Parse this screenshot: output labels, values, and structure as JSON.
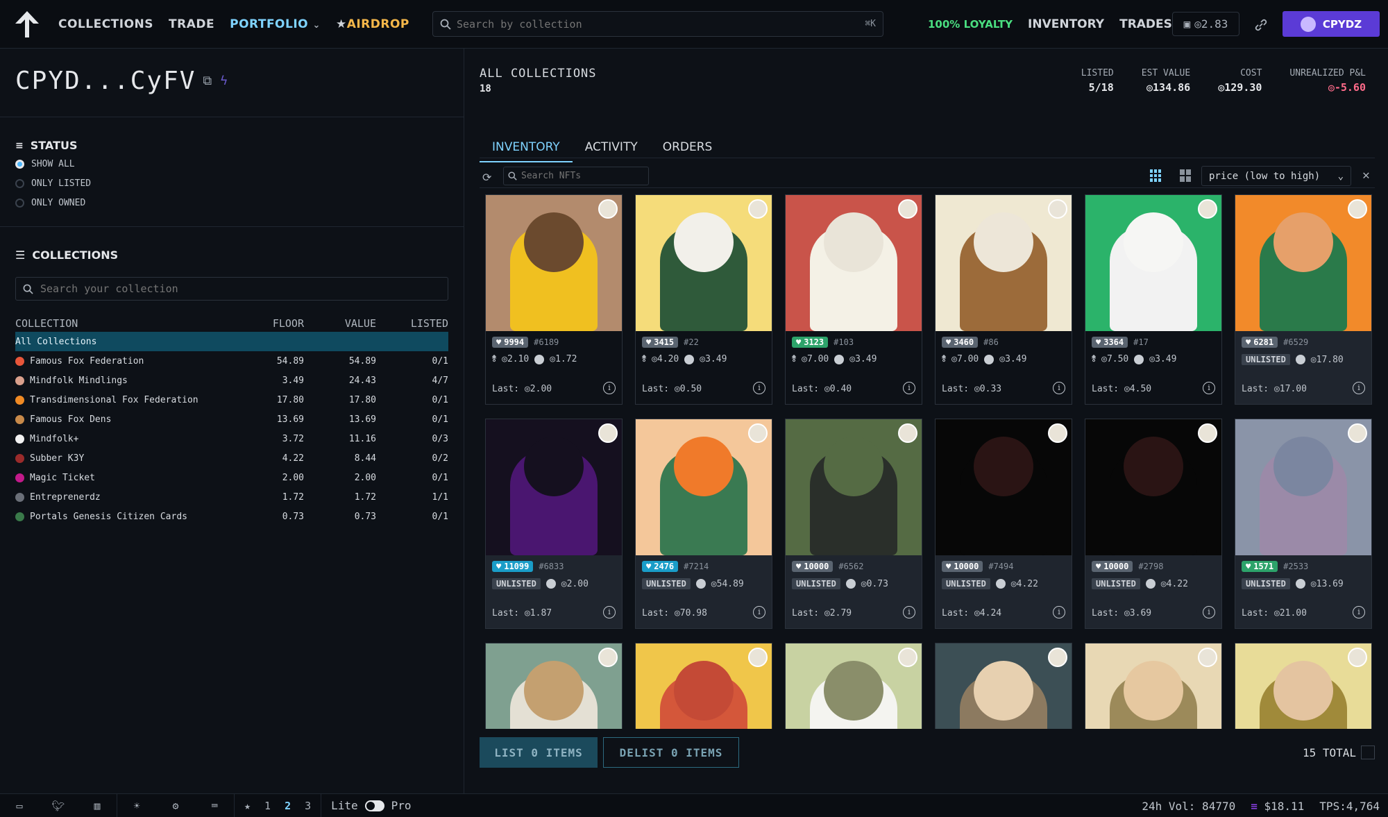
{
  "topnav": {
    "items": [
      "COLLECTIONS",
      "TRADE",
      "PORTFOLIO",
      "AIRDROP"
    ],
    "search_placeholder": "Search by collection",
    "search_kbd": "⌘K",
    "loyalty": "100% LOYALTY",
    "inventory": "INVENTORY",
    "trades": "TRADES",
    "wallet_balance": "◎2.83",
    "user": "CPYDZ"
  },
  "sidebar": {
    "address": "CPYD...CyFV",
    "status_title": "STATUS",
    "status_options": [
      "SHOW ALL",
      "ONLY LISTED",
      "ONLY OWNED"
    ],
    "collections_title": "COLLECTIONS",
    "collections_search_placeholder": "Search your collection",
    "headers": [
      "COLLECTION",
      "FLOOR",
      "VALUE",
      "LISTED"
    ],
    "rows": [
      {
        "name": "All Collections",
        "floor": "",
        "value": "",
        "listed": "",
        "color": ""
      },
      {
        "name": "Famous Fox Federation",
        "floor": "54.89",
        "value": "54.89",
        "listed": "0/1",
        "color": "#e8563a"
      },
      {
        "name": "Mindfolk Mindlings",
        "floor": "3.49",
        "value": "24.43",
        "listed": "4/7",
        "color": "#d9a08c"
      },
      {
        "name": "Transdimensional Fox Federation",
        "floor": "17.80",
        "value": "17.80",
        "listed": "0/1",
        "color": "#f08a24"
      },
      {
        "name": "Famous Fox Dens",
        "floor": "13.69",
        "value": "13.69",
        "listed": "0/1",
        "color": "#c88a4a"
      },
      {
        "name": "Mindfolk+",
        "floor": "3.72",
        "value": "11.16",
        "listed": "0/3",
        "color": "#f2f2f2"
      },
      {
        "name": "Subber K3Y",
        "floor": "4.22",
        "value": "8.44",
        "listed": "0/2",
        "color": "#9a2b2b"
      },
      {
        "name": "Magic Ticket",
        "floor": "2.00",
        "value": "2.00",
        "listed": "0/1",
        "color": "#c21a8a"
      },
      {
        "name": "Entreprenerdz",
        "floor": "1.72",
        "value": "1.72",
        "listed": "1/1",
        "color": "#6a6f78"
      },
      {
        "name": "Portals Genesis Citizen Cards",
        "floor": "0.73",
        "value": "0.73",
        "listed": "0/1",
        "color": "#3a7a4a"
      }
    ]
  },
  "main": {
    "title": "ALL COLLECTIONS",
    "count": "18",
    "stats": [
      {
        "label": "LISTED",
        "value": "5/18"
      },
      {
        "label": "EST VALUE",
        "value": "◎134.86"
      },
      {
        "label": "COST",
        "value": "◎129.30"
      },
      {
        "label": "UNREALIZED P&L",
        "value": "◎-5.60"
      }
    ],
    "tabs": [
      "INVENTORY",
      "ACTIVITY",
      "ORDERS"
    ],
    "nft_search_placeholder": "Search NFTs",
    "sort": "price (low to high)",
    "list_btn": "LIST 0 ITEMS",
    "delist_btn": "DELIST 0 ITEMS",
    "total": "15 TOTAL"
  },
  "cards": [
    {
      "rank": "9994",
      "id": "#6189",
      "listed": true,
      "price": "◎2.10",
      "floor": "◎1.72",
      "last": "Last: ◎2.00",
      "rank_color": "gray",
      "bg": "#b38b6d",
      "fig": "#f0c020",
      "head": "#6b4a2e"
    },
    {
      "rank": "3415",
      "id": "#22",
      "listed": true,
      "price": "◎4.20",
      "floor": "◎3.49",
      "last": "Last: ◎0.50",
      "rank_color": "gray",
      "bg": "#f5dc7a",
      "fig": "#2f5a3a",
      "head": "#f2f0ea"
    },
    {
      "rank": "3123",
      "id": "#103",
      "listed": true,
      "price": "◎7.00",
      "floor": "◎3.49",
      "last": "Last: ◎0.40",
      "rank_color": "green",
      "bg": "#c9544a",
      "fig": "#f4f1e6",
      "head": "#e9e4d8"
    },
    {
      "rank": "3460",
      "id": "#86",
      "listed": true,
      "price": "◎7.00",
      "floor": "◎3.49",
      "last": "Last: ◎0.33",
      "rank_color": "gray",
      "bg": "#efe8d2",
      "fig": "#9c6b3a",
      "head": "#ede6d8"
    },
    {
      "rank": "3364",
      "id": "#17",
      "listed": true,
      "price": "◎7.50",
      "floor": "◎3.49",
      "last": "Last: ◎4.50",
      "rank_color": "gray",
      "bg": "#2bb36a",
      "fig": "#f2f2f2",
      "head": "#f6f6f4"
    },
    {
      "rank": "6281",
      "id": "#6529",
      "listed": false,
      "price": "◎17.80",
      "floor": "",
      "last": "Last: ◎17.00",
      "rank_color": "gray",
      "bg": "#f28a2a",
      "fig": "#2a7a4a",
      "head": "#e6a06a"
    },
    {
      "rank": "11099",
      "id": "#6833",
      "listed": false,
      "price": "◎2.00",
      "floor": "",
      "last": "Last: ◎1.87",
      "rank_color": "blue",
      "bg": "#15101f",
      "fig": "#4a1670",
      "head": "#15101f"
    },
    {
      "rank": "2476",
      "id": "#7214",
      "listed": false,
      "price": "◎54.89",
      "floor": "",
      "last": "Last: ◎70.98",
      "rank_color": "blue",
      "bg": "#f4c79a",
      "fig": "#3a7a52",
      "head": "#f07a2a"
    },
    {
      "rank": "10000",
      "id": "#6562",
      "listed": false,
      "price": "◎0.73",
      "floor": "",
      "last": "Last: ◎2.79",
      "rank_color": "gray",
      "bg": "#556b44",
      "fig": "#2a2f2a",
      "head": "#556b44"
    },
    {
      "rank": "10000",
      "id": "#7494",
      "listed": false,
      "price": "◎4.22",
      "floor": "",
      "last": "Last: ◎4.24",
      "rank_color": "gray",
      "bg": "#070707",
      "fig": "#070707",
      "head": "#2a1414"
    },
    {
      "rank": "10000",
      "id": "#2798",
      "listed": false,
      "price": "◎4.22",
      "floor": "",
      "last": "Last: ◎3.69",
      "rank_color": "gray",
      "bg": "#070707",
      "fig": "#070707",
      "head": "#2a1414"
    },
    {
      "rank": "1571",
      "id": "#2533",
      "listed": false,
      "price": "◎13.69",
      "floor": "",
      "last": "Last: ◎21.00",
      "rank_color": "green",
      "bg": "#8a94a8",
      "fig": "#9b8aa8",
      "head": "#7b86a0"
    },
    {
      "rank": "",
      "id": "",
      "listed": true,
      "price": "",
      "floor": "",
      "last": "",
      "rank_color": "gray",
      "bg": "#7fa090",
      "fig": "#e4e0d4",
      "head": "#c4a070"
    },
    {
      "rank": "",
      "id": "",
      "listed": true,
      "price": "",
      "floor": "",
      "last": "",
      "rank_color": "gray",
      "bg": "#f0c64a",
      "fig": "#d4573a",
      "head": "#c44a36"
    },
    {
      "rank": "",
      "id": "",
      "listed": true,
      "price": "",
      "floor": "",
      "last": "",
      "rank_color": "gray",
      "bg": "#c8d2a2",
      "fig": "#f4f4f0",
      "head": "#8a8e6a"
    },
    {
      "rank": "",
      "id": "",
      "listed": true,
      "price": "",
      "floor": "",
      "last": "",
      "rank_color": "gray",
      "bg": "#3c4f55",
      "fig": "#8c7a60",
      "head": "#e7d0b0"
    },
    {
      "rank": "",
      "id": "",
      "listed": true,
      "price": "",
      "floor": "",
      "last": "",
      "rank_color": "gray",
      "bg": "#e8d8b4",
      "fig": "#9c8a5a",
      "head": "#e6c8a0"
    },
    {
      "rank": "",
      "id": "",
      "listed": true,
      "price": "",
      "floor": "",
      "last": "",
      "rank_color": "gray",
      "bg": "#e8dc98",
      "fig": "#a08a3a",
      "head": "#e4c4a0"
    }
  ],
  "statusbar": {
    "favs": [
      "1",
      "2",
      "3"
    ],
    "lite": "Lite",
    "pro": "Pro",
    "vol": "24h Vol: 84770",
    "sol": "$18.11",
    "tps": "TPS:4,764"
  }
}
